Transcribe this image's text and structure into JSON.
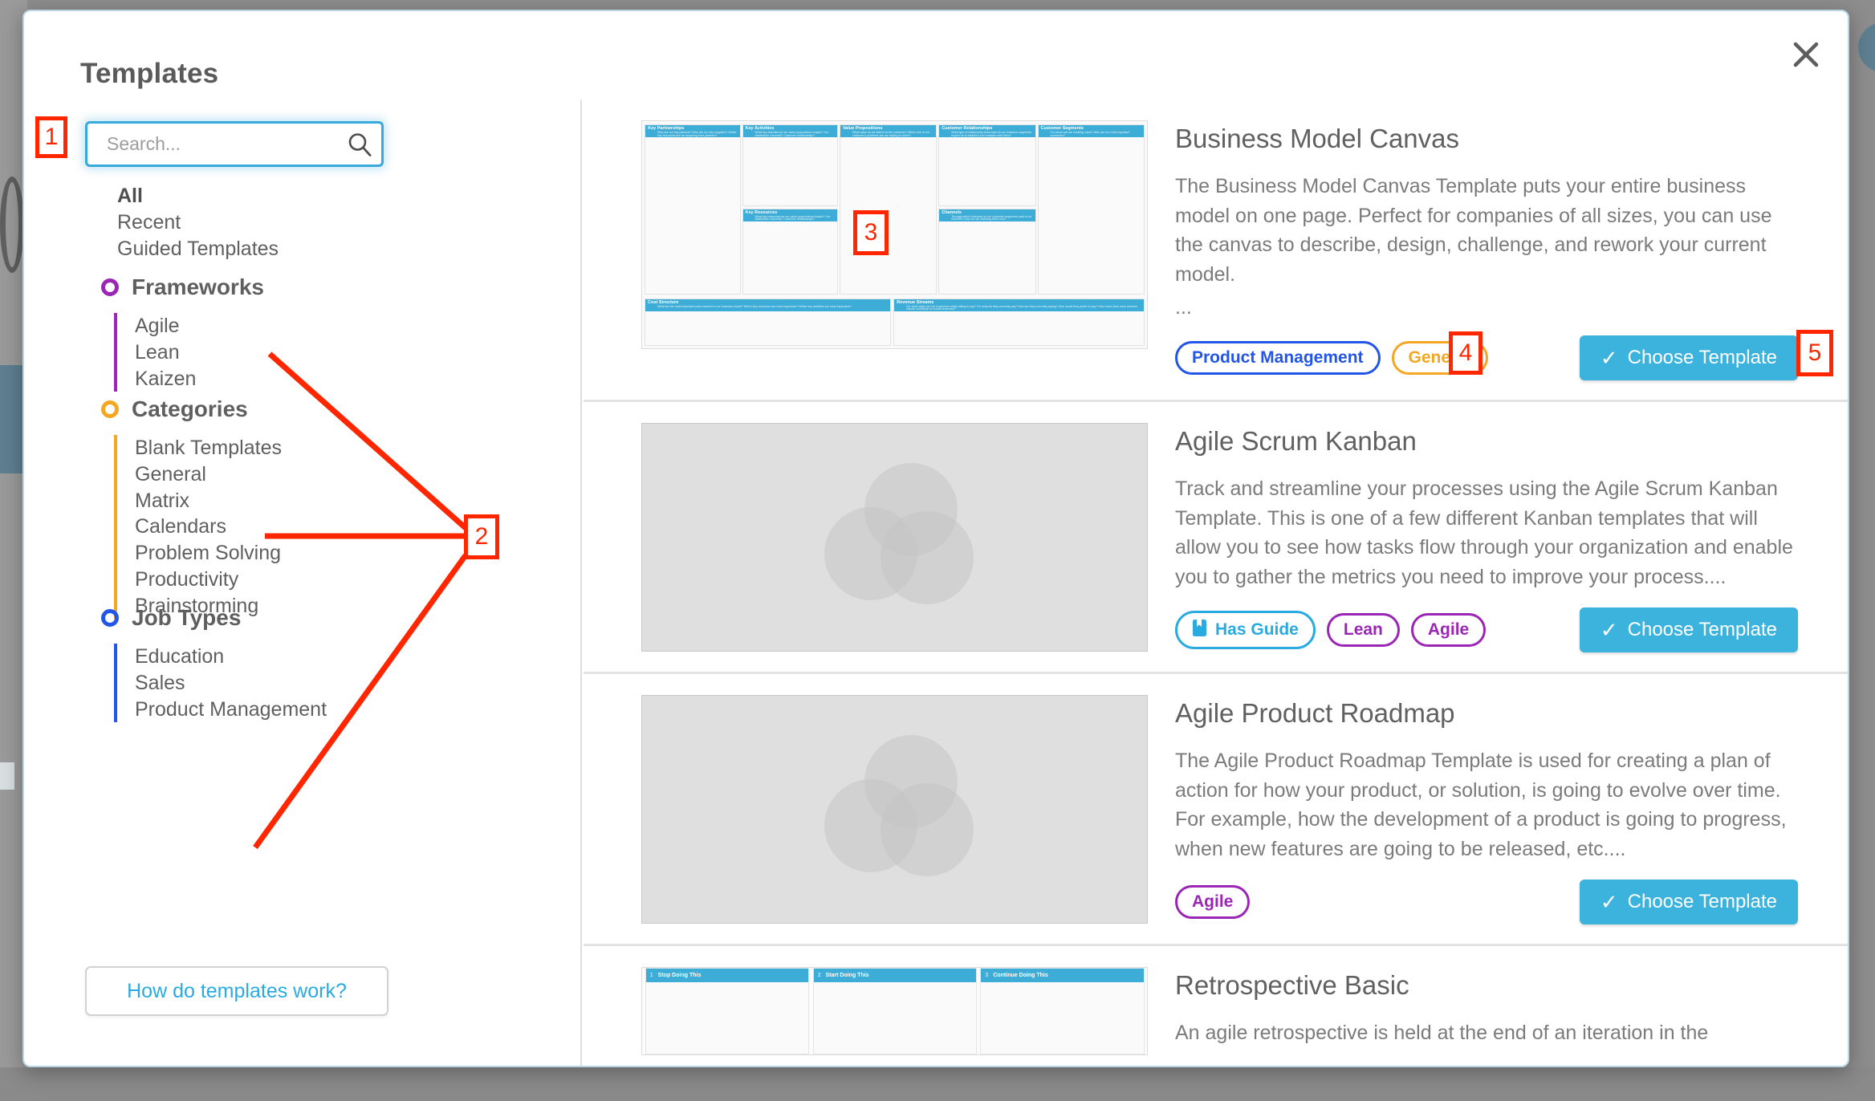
{
  "modal": {
    "title": "Templates",
    "close_label": "✕"
  },
  "search": {
    "placeholder": "Search...",
    "value": "",
    "icon": "search-icon"
  },
  "sidebar": {
    "top_links": [
      {
        "label": "All",
        "active": true
      },
      {
        "label": "Recent",
        "active": false
      },
      {
        "label": "Guided Templates",
        "active": false
      }
    ],
    "groups": [
      {
        "name": "Frameworks",
        "color": "#9b26b6",
        "items": [
          "Agile",
          "Lean",
          "Kaizen"
        ]
      },
      {
        "name": "Categories",
        "color": "#f5a623",
        "items": [
          "Blank Templates",
          "General",
          "Matrix",
          "Calendars",
          "Problem Solving",
          "Productivity",
          "Brainstorming"
        ]
      },
      {
        "name": "Job Types",
        "color": "#2255e8",
        "items": [
          "Education",
          "Sales",
          "Product Management"
        ]
      }
    ],
    "help_button": "How do templates work?"
  },
  "templates": [
    {
      "title": "Business Model Canvas",
      "description": "The Business Model Canvas Template puts your entire business model on one page. Perfect for companies of all sizes, you can use the canvas to describe, design, challenge, and rework your current model.",
      "ellipsis": "...",
      "tags": [
        {
          "label": "Product Management",
          "color": "#2255e8",
          "icon": ""
        },
        {
          "label": "General",
          "color": "#f5a623",
          "icon": ""
        }
      ],
      "choose_label": "Choose Template",
      "thumb_type": "business-model-canvas",
      "thumb_cells": [
        {
          "title": "Key Partnerships",
          "sub": "Who are our key partners? Who are our key suppliers? Which key resources are we acquiring from partners?"
        },
        {
          "title": "Key Activities",
          "sub": "What key activities do our value propositions require? Our distribution channels? Customer relationships?"
        },
        {
          "title": "Key Resources",
          "sub": "What key resources do our value propositions require? Our distribution channels? Customer relationships?"
        },
        {
          "title": "Value Propositions",
          "sub": "What value do we deliver to the customer? Which one of our customer's problems are we helping to solve?"
        },
        {
          "title": "Customer Relationships",
          "sub": "What type of relationship does each of our customer segments expect us to establish and maintain with them?"
        },
        {
          "title": "Channels",
          "sub": "Through which channels do our customer segments want to be reached? How are we reaching them now?"
        },
        {
          "title": "Customer Segments",
          "sub": "For whom are we creating value? Who are our most important customers?"
        },
        {
          "title": "Cost Structure",
          "sub": "What are the most important costs inherent in our business model? Which key resources are most expensive? Which key activities are most expensive?"
        },
        {
          "title": "Revenue Streams",
          "sub": "For what value are our customers really willing to pay? For what do they currently pay? How are they currently paying? How would they prefer to pay? How much does each revenue stream contribute to overall revenues?"
        }
      ]
    },
    {
      "title": "Agile Scrum Kanban",
      "description": "Track and streamline your processes using the Agile Scrum Kanban Template. This is one of a few different Kanban templates that will allow you to see how tasks flow through your organization and enable you to gather the metrics you need to improve your process....",
      "ellipsis": "",
      "tags": [
        {
          "label": "Has Guide",
          "color": "#29abe2",
          "icon": "book-icon"
        },
        {
          "label": "Lean",
          "color": "#9b26b6",
          "icon": ""
        },
        {
          "label": "Agile",
          "color": "#9b26b6",
          "icon": ""
        }
      ],
      "choose_label": "Choose Template",
      "thumb_type": "placeholder",
      "thumb_cells": []
    },
    {
      "title": "Agile Product Roadmap",
      "description": "The Agile Product Roadmap Template is used for creating a plan of action for how your product, or solution, is going to evolve over time. For example, how the development of a product is going to progress, when new features are going to be released, etc....",
      "ellipsis": "",
      "tags": [
        {
          "label": "Agile",
          "color": "#9b26b6",
          "icon": ""
        }
      ],
      "choose_label": "Choose Template",
      "thumb_type": "placeholder",
      "thumb_cells": []
    },
    {
      "title": "Retrospective Basic",
      "description": "An agile retrospective is held at the end of an iteration in the",
      "ellipsis": "",
      "tags": [],
      "choose_label": "",
      "thumb_type": "retrospective",
      "thumb_cells": [
        {
          "title": "Stop Doing This",
          "sub": "1"
        },
        {
          "title": "Start Doing This",
          "sub": "2"
        },
        {
          "title": "Continue Doing This",
          "sub": "3"
        }
      ]
    }
  ],
  "annotations": [
    {
      "id": "1",
      "label": "1"
    },
    {
      "id": "2",
      "label": "2"
    },
    {
      "id": "3",
      "label": "3"
    },
    {
      "id": "4",
      "label": "4"
    },
    {
      "id": "5",
      "label": "5"
    }
  ]
}
